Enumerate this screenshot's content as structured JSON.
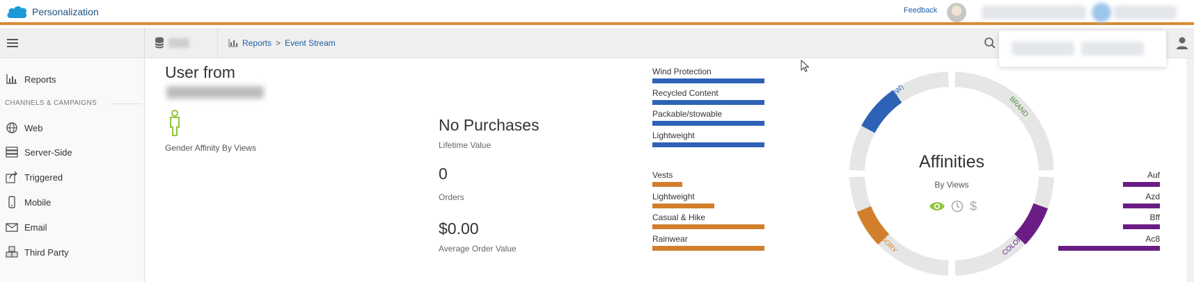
{
  "header": {
    "app_name": "Personalization",
    "feedback_label": "Feedback",
    "accent_color": "#d88a33"
  },
  "subbar": {
    "breadcrumb": [
      "Reports",
      "Event Stream"
    ],
    "breadcrumb_separator": ">"
  },
  "sidebar": {
    "reports_label": "Reports",
    "section_label": "CHANNELS & CAMPAIGNS",
    "items": [
      {
        "label": "Web",
        "icon": "globe-icon"
      },
      {
        "label": "Server-Side",
        "icon": "server-icon"
      },
      {
        "label": "Triggered",
        "icon": "share-icon"
      },
      {
        "label": "Mobile",
        "icon": "mobile-icon"
      },
      {
        "label": "Email",
        "icon": "envelope-icon"
      },
      {
        "label": "Third Party",
        "icon": "cubes-icon"
      }
    ]
  },
  "profile": {
    "title": "User from",
    "gender_label": "Gender Affinity By Views",
    "purchases_title": "No Purchases",
    "lifetime_label": "Lifetime Value",
    "orders_value": "0",
    "orders_label": "Orders",
    "aov_value": "$0.00",
    "aov_label": "Average Order Value"
  },
  "affinities": {
    "title": "Affinities",
    "subtitle": "By Views",
    "segments": [
      {
        "name": "FEATURE (NEW)",
        "color": "#2d62b7"
      },
      {
        "name": "BRAND",
        "color": "#4b8b3b"
      },
      {
        "name": "COLOR (NEW)",
        "color": "#6a1d84"
      },
      {
        "name": "CATEGORY",
        "color": "#d27f2c"
      }
    ],
    "feature_bars": [
      {
        "label": "Wind Protection",
        "value": 1.0
      },
      {
        "label": "Recycled Content",
        "value": 1.0
      },
      {
        "label": "Packable/stowable",
        "value": 1.0
      },
      {
        "label": "Lightweight",
        "value": 1.0
      }
    ],
    "category_bars": [
      {
        "label": "Vests",
        "value": 0.27
      },
      {
        "label": "Lightweight",
        "value": 0.55
      },
      {
        "label": "Casual & Hike",
        "value": 1.0
      },
      {
        "label": "Rainwear",
        "value": 1.0
      }
    ],
    "color_bars": [
      {
        "label": "Auf",
        "value": 0.36
      },
      {
        "label": "Azd",
        "value": 0.36
      },
      {
        "label": "Bff",
        "value": 0.36
      },
      {
        "label": "Ac8",
        "value": 1.0
      }
    ]
  }
}
